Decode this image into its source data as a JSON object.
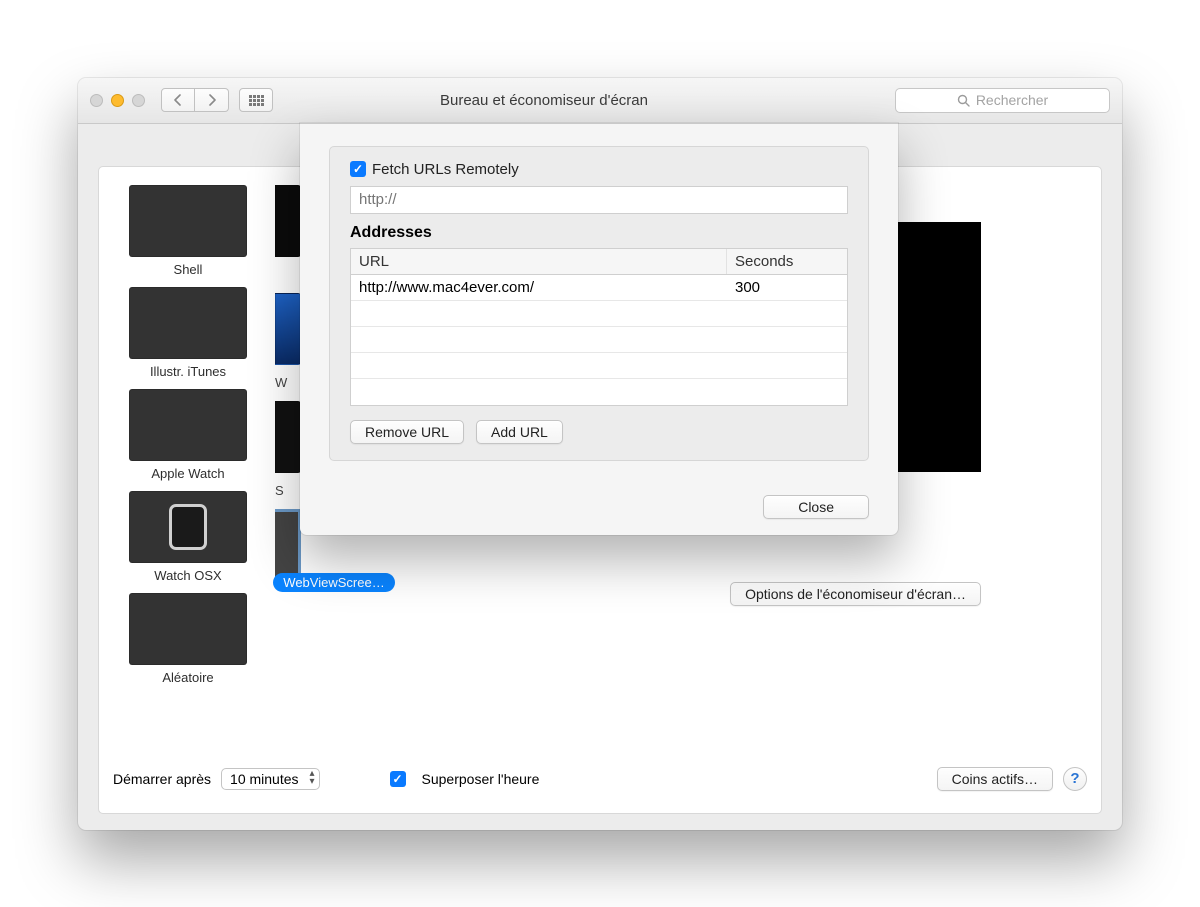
{
  "window": {
    "title": "Bureau et économiseur d'écran"
  },
  "search": {
    "placeholder": "Rechercher"
  },
  "screensavers": [
    {
      "label": "Shell"
    },
    {
      "label": "Illustr. iTunes"
    },
    {
      "label": "Apple Watch"
    },
    {
      "label": "Watch OSX"
    },
    {
      "label": "Aléatoire"
    },
    {
      "label": "WebViewScree…"
    }
  ],
  "partial_labels": {
    "itunes_row": "W",
    "aw_row": "S"
  },
  "options_button": "Options de l'économiseur d'écran…",
  "bottom": {
    "start_after_label": "Démarrer après",
    "start_after_value": "10 minutes",
    "overlay_clock_label": "Superposer l'heure",
    "hot_corners": "Coins actifs…"
  },
  "modal": {
    "fetch_label": "Fetch URLs Remotely",
    "fetch_checked": true,
    "url_placeholder": "http://",
    "addresses_title": "Addresses",
    "headers": {
      "url": "URL",
      "seconds": "Seconds"
    },
    "rows": [
      {
        "url": "http://www.mac4ever.com/",
        "seconds": "300"
      },
      {
        "url": "",
        "seconds": ""
      },
      {
        "url": "",
        "seconds": ""
      },
      {
        "url": "",
        "seconds": ""
      },
      {
        "url": "",
        "seconds": ""
      }
    ],
    "remove": "Remove URL",
    "add": "Add URL",
    "close": "Close"
  }
}
